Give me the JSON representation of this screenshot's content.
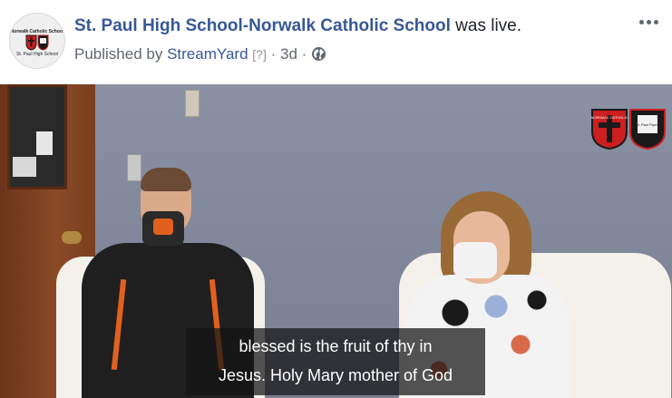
{
  "post": {
    "page_name": "St. Paul High School-Norwalk Catholic School",
    "status_text": "was live.",
    "published_prefix": "Published by",
    "publisher": "StreamYard",
    "help_marker": "[?]",
    "separator": "·",
    "age": "3d",
    "audience_icon": "globe-icon",
    "more_icon": "more-options-icon"
  },
  "avatar": {
    "top_text": "Norwalk Catholic School",
    "bottom_text": "St. Paul High School"
  },
  "video": {
    "watermark": {
      "left_shield_text": "NORWALK CATHOLIC",
      "right_shield_text": "St. Paul Flyers"
    },
    "caption": {
      "line1": "blessed is the fruit of thy in",
      "line2": "Jesus. Holy Mary mother of God"
    }
  },
  "colors": {
    "link": "#385898",
    "text": "#1d2129",
    "secondary": "#606770",
    "shield_red": "#cc1f1f",
    "shield_black": "#1a1a1a"
  }
}
